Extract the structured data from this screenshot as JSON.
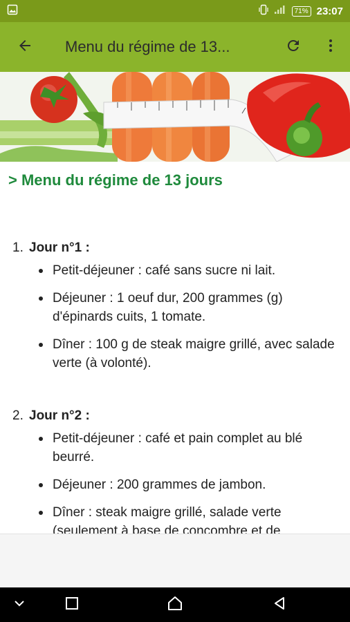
{
  "status_bar": {
    "battery": "71%",
    "time": "23:07"
  },
  "app_bar": {
    "title": "Menu du régime de 13..."
  },
  "content": {
    "heading": "> Menu du régime de 13 jours",
    "days": [
      {
        "number": "1.",
        "title": "Jour n°1 :",
        "meals": [
          "Petit-déjeuner : café sans sucre ni lait.",
          "Déjeuner : 1 oeuf dur, 200 grammes (g) d'épinards cuits, 1 tomate.",
          "Dîner : 100 g de steak maigre grillé, avec salade verte (à volonté)."
        ]
      },
      {
        "number": "2.",
        "title": "Jour n°2 :",
        "meals": [
          "Petit-déjeuner : café et pain complet au blé beurré.",
          "Déjeuner : 200 grammes de jambon.",
          "Dîner : steak maigre grillé, salade verte (seulement à base de concombre et de"
        ]
      }
    ]
  },
  "colors": {
    "status_bar": "#7a9a1a",
    "app_bar": "#8bb42b",
    "heading": "#1f8a3c"
  }
}
